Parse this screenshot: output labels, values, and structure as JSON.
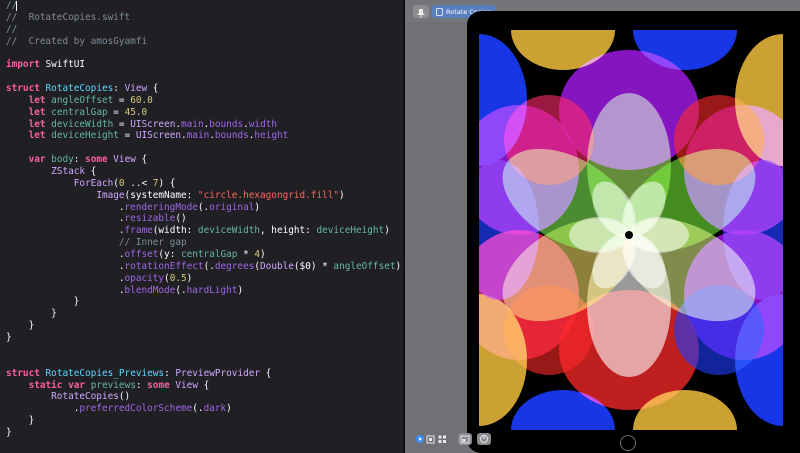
{
  "editor": {
    "lines": [
      [
        {
          "t": "//",
          "c": "comment"
        }
      ],
      [
        {
          "t": "//  RotateCopies.swift",
          "c": "comment"
        }
      ],
      [
        {
          "t": "//",
          "c": "comment"
        }
      ],
      [
        {
          "t": "//  Created by amosGyamfi",
          "c": "comment"
        }
      ],
      [],
      [
        {
          "t": "import",
          "c": "keyword"
        },
        {
          "t": " SwiftUI",
          "c": "plain"
        }
      ],
      [],
      [
        {
          "t": "struct",
          "c": "keyword"
        },
        {
          "t": " ",
          "c": "plain"
        },
        {
          "t": "RotateCopies",
          "c": "typeref"
        },
        {
          "t": ": ",
          "c": "plain"
        },
        {
          "t": "View",
          "c": "type"
        },
        {
          "t": " {",
          "c": "plain"
        }
      ],
      [
        {
          "t": "    ",
          "c": "plain"
        },
        {
          "t": "let",
          "c": "keyword"
        },
        {
          "t": " ",
          "c": "plain"
        },
        {
          "t": "angleOffset",
          "c": "var"
        },
        {
          "t": " = ",
          "c": "plain"
        },
        {
          "t": "60.0",
          "c": "number"
        }
      ],
      [
        {
          "t": "    ",
          "c": "plain"
        },
        {
          "t": "let",
          "c": "keyword"
        },
        {
          "t": " ",
          "c": "plain"
        },
        {
          "t": "centralGap",
          "c": "var"
        },
        {
          "t": " = ",
          "c": "plain"
        },
        {
          "t": "45.0",
          "c": "number"
        }
      ],
      [
        {
          "t": "    ",
          "c": "plain"
        },
        {
          "t": "let",
          "c": "keyword"
        },
        {
          "t": " ",
          "c": "plain"
        },
        {
          "t": "deviceWidth",
          "c": "var"
        },
        {
          "t": " = ",
          "c": "plain"
        },
        {
          "t": "UIScreen",
          "c": "type"
        },
        {
          "t": ".",
          "c": "plain"
        },
        {
          "t": "main",
          "c": "method"
        },
        {
          "t": ".",
          "c": "plain"
        },
        {
          "t": "bounds",
          "c": "method"
        },
        {
          "t": ".",
          "c": "plain"
        },
        {
          "t": "width",
          "c": "method"
        }
      ],
      [
        {
          "t": "    ",
          "c": "plain"
        },
        {
          "t": "let",
          "c": "keyword"
        },
        {
          "t": " ",
          "c": "plain"
        },
        {
          "t": "deviceHeight",
          "c": "var"
        },
        {
          "t": " = ",
          "c": "plain"
        },
        {
          "t": "UIScreen",
          "c": "type"
        },
        {
          "t": ".",
          "c": "plain"
        },
        {
          "t": "main",
          "c": "method"
        },
        {
          "t": ".",
          "c": "plain"
        },
        {
          "t": "bounds",
          "c": "method"
        },
        {
          "t": ".",
          "c": "plain"
        },
        {
          "t": "height",
          "c": "method"
        }
      ],
      [],
      [
        {
          "t": "    ",
          "c": "plain"
        },
        {
          "t": "var",
          "c": "keyword"
        },
        {
          "t": " ",
          "c": "plain"
        },
        {
          "t": "body",
          "c": "var"
        },
        {
          "t": ": ",
          "c": "plain"
        },
        {
          "t": "some",
          "c": "keyword"
        },
        {
          "t": " ",
          "c": "plain"
        },
        {
          "t": "View",
          "c": "type"
        },
        {
          "t": " {",
          "c": "plain"
        }
      ],
      [
        {
          "t": "        ",
          "c": "plain"
        },
        {
          "t": "ZStack",
          "c": "type"
        },
        {
          "t": " {",
          "c": "plain"
        }
      ],
      [
        {
          "t": "            ",
          "c": "plain"
        },
        {
          "t": "ForEach",
          "c": "type"
        },
        {
          "t": "(",
          "c": "plain"
        },
        {
          "t": "0",
          "c": "number"
        },
        {
          "t": " ..< ",
          "c": "plain"
        },
        {
          "t": "7",
          "c": "number"
        },
        {
          "t": ") {",
          "c": "plain"
        }
      ],
      [
        {
          "t": "                ",
          "c": "plain"
        },
        {
          "t": "Image",
          "c": "type"
        },
        {
          "t": "(systemName: ",
          "c": "plain"
        },
        {
          "t": "\"circle.hexagongrid.fill\"",
          "c": "string"
        },
        {
          "t": ")",
          "c": "plain"
        }
      ],
      [
        {
          "t": "                    .",
          "c": "plain"
        },
        {
          "t": "renderingMode",
          "c": "method"
        },
        {
          "t": "(.",
          "c": "plain"
        },
        {
          "t": "original",
          "c": "method"
        },
        {
          "t": ")",
          "c": "plain"
        }
      ],
      [
        {
          "t": "                    .",
          "c": "plain"
        },
        {
          "t": "resizable",
          "c": "method"
        },
        {
          "t": "()",
          "c": "plain"
        }
      ],
      [
        {
          "t": "                    .",
          "c": "plain"
        },
        {
          "t": "frame",
          "c": "method"
        },
        {
          "t": "(width: ",
          "c": "plain"
        },
        {
          "t": "deviceWidth",
          "c": "var"
        },
        {
          "t": ", height: ",
          "c": "plain"
        },
        {
          "t": "deviceHeight",
          "c": "var"
        },
        {
          "t": ")",
          "c": "plain"
        }
      ],
      [
        {
          "t": "                    // Inner gap",
          "c": "comment"
        }
      ],
      [
        {
          "t": "                    .",
          "c": "plain"
        },
        {
          "t": "offset",
          "c": "method"
        },
        {
          "t": "(y: ",
          "c": "plain"
        },
        {
          "t": "centralGap",
          "c": "var"
        },
        {
          "t": " * ",
          "c": "plain"
        },
        {
          "t": "4",
          "c": "number"
        },
        {
          "t": ")",
          "c": "plain"
        }
      ],
      [
        {
          "t": "                    .",
          "c": "plain"
        },
        {
          "t": "rotationEffect",
          "c": "method"
        },
        {
          "t": "(.",
          "c": "plain"
        },
        {
          "t": "degrees",
          "c": "method"
        },
        {
          "t": "(",
          "c": "plain"
        },
        {
          "t": "Double",
          "c": "type"
        },
        {
          "t": "($0) * ",
          "c": "plain"
        },
        {
          "t": "angleOffset",
          "c": "var"
        },
        {
          "t": "))",
          "c": "plain"
        }
      ],
      [
        {
          "t": "                    .",
          "c": "plain"
        },
        {
          "t": "opacity",
          "c": "method"
        },
        {
          "t": "(",
          "c": "plain"
        },
        {
          "t": "0.5",
          "c": "number"
        },
        {
          "t": ")",
          "c": "plain"
        }
      ],
      [
        {
          "t": "                    .",
          "c": "plain"
        },
        {
          "t": "blendMode",
          "c": "method"
        },
        {
          "t": "(.",
          "c": "plain"
        },
        {
          "t": "hardLight",
          "c": "method"
        },
        {
          "t": ")",
          "c": "plain"
        }
      ],
      [
        {
          "t": "            }",
          "c": "plain"
        }
      ],
      [
        {
          "t": "        }",
          "c": "plain"
        }
      ],
      [
        {
          "t": "    }",
          "c": "plain"
        }
      ],
      [
        {
          "t": "}",
          "c": "plain"
        }
      ],
      [],
      [],
      [
        {
          "t": "struct",
          "c": "keyword"
        },
        {
          "t": " ",
          "c": "plain"
        },
        {
          "t": "RotateCopies_Previews",
          "c": "typeref"
        },
        {
          "t": ": ",
          "c": "plain"
        },
        {
          "t": "PreviewProvider",
          "c": "type"
        },
        {
          "t": " {",
          "c": "plain"
        }
      ],
      [
        {
          "t": "    ",
          "c": "plain"
        },
        {
          "t": "static",
          "c": "keyword"
        },
        {
          "t": " ",
          "c": "plain"
        },
        {
          "t": "var",
          "c": "keyword"
        },
        {
          "t": " ",
          "c": "plain"
        },
        {
          "t": "previews",
          "c": "var"
        },
        {
          "t": ": ",
          "c": "plain"
        },
        {
          "t": "some",
          "c": "keyword"
        },
        {
          "t": " ",
          "c": "plain"
        },
        {
          "t": "View",
          "c": "type"
        },
        {
          "t": " {",
          "c": "plain"
        }
      ],
      [
        {
          "t": "        ",
          "c": "plain"
        },
        {
          "t": "RotateCopies",
          "c": "type"
        },
        {
          "t": "()",
          "c": "plain"
        }
      ],
      [
        {
          "t": "            .",
          "c": "plain"
        },
        {
          "t": "preferredColorScheme",
          "c": "method"
        },
        {
          "t": "(.",
          "c": "plain"
        },
        {
          "t": "dark",
          "c": "method"
        },
        {
          "t": ")",
          "c": "plain"
        }
      ],
      [
        {
          "t": "    }",
          "c": "plain"
        }
      ],
      [
        {
          "t": "}",
          "c": "plain"
        }
      ]
    ]
  },
  "preview": {
    "pill_label": "Rotate Copies",
    "pin_icon": "pin-icon",
    "pill_icon": "device-icon",
    "bottom_icons": [
      "live-preview-icon",
      "inspect-icon",
      "grid-icon",
      "device-settings-icon",
      "duplicate-icon"
    ],
    "copies": 7,
    "angle_offset": 60.0,
    "opacity": 0.5,
    "blend_mode": "hardLight",
    "colors": {
      "accent": "#5a7fbf",
      "blue": "#1c3cff",
      "red": "#ff2a2a",
      "green": "#7bff3a",
      "white": "#ffffff",
      "orange": "#ff8a1a",
      "purple": "#b01cff",
      "yellow": "#e2b23a",
      "black": "#000000"
    }
  }
}
